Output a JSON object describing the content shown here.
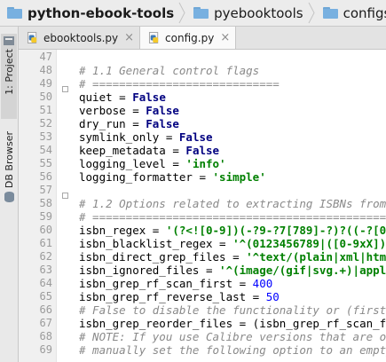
{
  "breadcrumb": [
    {
      "icon": "folder-icon",
      "label": "python-ebook-tools"
    },
    {
      "icon": "folder-icon",
      "label": "pyebooktools"
    },
    {
      "icon": "folder-icon",
      "label": "configs"
    },
    {
      "icon": "python-file-icon",
      "label": "config.py"
    }
  ],
  "sidebar": {
    "project_tab": "1: Project",
    "db_tab": "DB Browser"
  },
  "tabs": [
    {
      "label": "ebooktools.py",
      "close": "×",
      "active": false
    },
    {
      "label": "config.py",
      "close": "×",
      "active": true
    }
  ],
  "editor": {
    "lines": [
      {
        "num": "47",
        "tokens": []
      },
      {
        "num": "48",
        "tokens": [
          {
            "t": "# 1.1 General control flags",
            "c": "com"
          }
        ]
      },
      {
        "num": "49",
        "tokens": [
          {
            "t": "# ============================",
            "c": "com"
          }
        ]
      },
      {
        "num": "50",
        "tokens": [
          {
            "t": "quiet = ",
            "c": "id"
          },
          {
            "t": "False",
            "c": "kw"
          }
        ]
      },
      {
        "num": "51",
        "tokens": [
          {
            "t": "verbose = ",
            "c": "id"
          },
          {
            "t": "False",
            "c": "kw"
          }
        ]
      },
      {
        "num": "52",
        "tokens": [
          {
            "t": "dry_run = ",
            "c": "id"
          },
          {
            "t": "False",
            "c": "kw"
          }
        ]
      },
      {
        "num": "53",
        "tokens": [
          {
            "t": "symlink_only = ",
            "c": "id"
          },
          {
            "t": "False",
            "c": "kw"
          }
        ]
      },
      {
        "num": "54",
        "tokens": [
          {
            "t": "keep_metadata = ",
            "c": "id"
          },
          {
            "t": "False",
            "c": "kw"
          }
        ]
      },
      {
        "num": "55",
        "tokens": [
          {
            "t": "logging_level = ",
            "c": "id"
          },
          {
            "t": "'info'",
            "c": "str"
          }
        ]
      },
      {
        "num": "56",
        "tokens": [
          {
            "t": "logging_formatter = ",
            "c": "id"
          },
          {
            "t": "'simple'",
            "c": "str"
          }
        ]
      },
      {
        "num": "57",
        "tokens": []
      },
      {
        "num": "58",
        "tokens": [
          {
            "t": "# 1.2 Options related to extracting ISBNs from fi",
            "c": "com"
          }
        ]
      },
      {
        "num": "59",
        "tokens": [
          {
            "t": "# ================================================",
            "c": "com"
          }
        ]
      },
      {
        "num": "60",
        "tokens": [
          {
            "t": "isbn_regex = ",
            "c": "id"
          },
          {
            "t": "'(?<![0-9])(-?9-?7[789]-?)?((-?[0-9]-",
            "c": "str"
          }
        ]
      },
      {
        "num": "61",
        "tokens": [
          {
            "t": "isbn_blacklist_regex = ",
            "c": "id"
          },
          {
            "t": "'^(0123456789|([0-9xX])",
            "c": "str"
          },
          {
            "t": "\\\\",
            "c": "esc"
          },
          {
            "t": "2",
            "c": "str"
          }
        ]
      },
      {
        "num": "62",
        "tokens": [
          {
            "t": "isbn_direct_grep_files = ",
            "c": "id"
          },
          {
            "t": "'^text/(plain|xml|html)$'",
            "c": "str"
          }
        ]
      },
      {
        "num": "63",
        "tokens": [
          {
            "t": "isbn_ignored_files = ",
            "c": "id"
          },
          {
            "t": "'^(image/(gif|svg.+)|applicat",
            "c": "str"
          }
        ]
      },
      {
        "num": "64",
        "tokens": [
          {
            "t": "isbn_grep_rf_scan_first = ",
            "c": "id"
          },
          {
            "t": "400",
            "c": "num"
          }
        ]
      },
      {
        "num": "65",
        "tokens": [
          {
            "t": "isbn_grep_rf_reverse_last = ",
            "c": "id"
          },
          {
            "t": "50",
            "c": "num"
          }
        ]
      },
      {
        "num": "66",
        "tokens": [
          {
            "t": "# False to disable the functionality or (first_lin",
            "c": "com"
          }
        ]
      },
      {
        "num": "67",
        "tokens": [
          {
            "t": "isbn_grep_reorder_files = (isbn_grep_rf_scan_first",
            "c": "id"
          }
        ]
      },
      {
        "num": "68",
        "tokens": [
          {
            "t": "# NOTE: If you use Calibre versions that are older",
            "c": "com"
          }
        ]
      },
      {
        "num": "69",
        "tokens": [
          {
            "t": "# manually set the following option to an empty st",
            "c": "com"
          }
        ]
      }
    ]
  }
}
